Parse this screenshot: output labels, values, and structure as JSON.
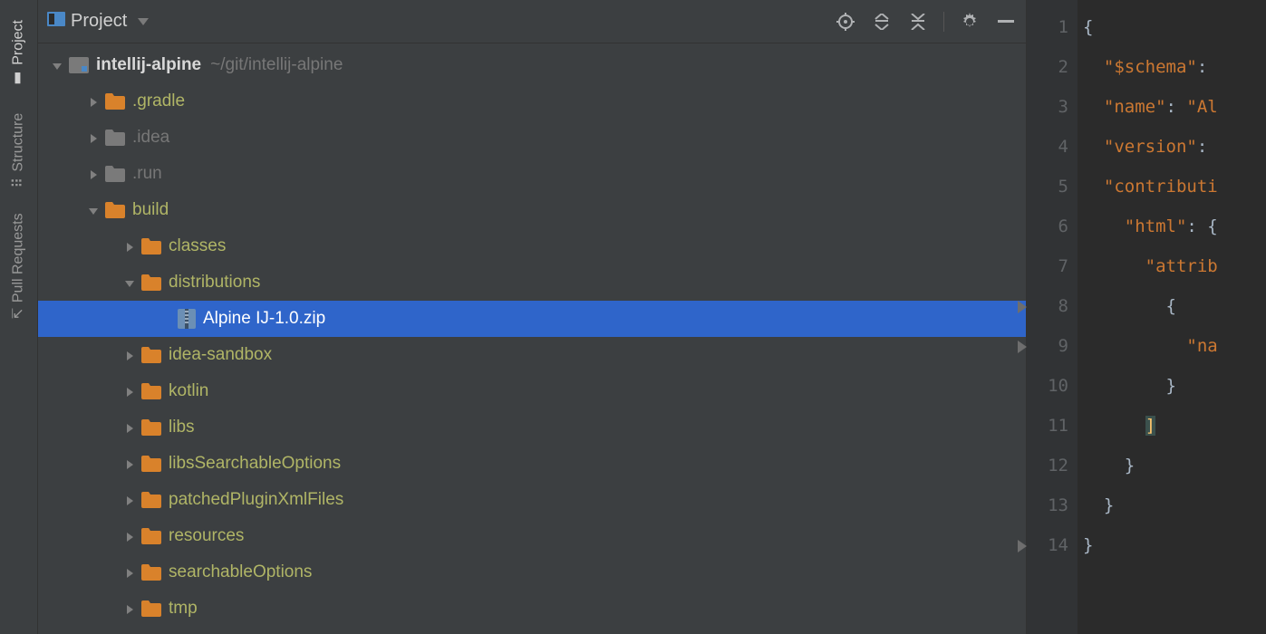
{
  "sidebar": {
    "tabs": [
      {
        "label": "Project",
        "active": true
      },
      {
        "label": "Structure",
        "active": false
      },
      {
        "label": "Pull Requests",
        "active": false
      }
    ]
  },
  "panel": {
    "title": "Project"
  },
  "tree": {
    "root": {
      "label": "intellij-alpine",
      "path": "~/git/intellij-alpine"
    },
    "nodes": [
      {
        "indent": 1,
        "kind": "folder-orange",
        "label": ".gradle",
        "expand": "closed"
      },
      {
        "indent": 1,
        "kind": "folder-gray",
        "label": ".idea",
        "expand": "closed",
        "dim": true
      },
      {
        "indent": 1,
        "kind": "folder-gray",
        "label": ".run",
        "expand": "closed",
        "dim": true
      },
      {
        "indent": 1,
        "kind": "folder-orange",
        "label": "build",
        "expand": "open"
      },
      {
        "indent": 2,
        "kind": "folder-orange",
        "label": "classes",
        "expand": "closed"
      },
      {
        "indent": 2,
        "kind": "folder-orange",
        "label": "distributions",
        "expand": "open"
      },
      {
        "indent": 3,
        "kind": "zip",
        "label": "Alpine IJ-1.0.zip",
        "selected": true
      },
      {
        "indent": 2,
        "kind": "folder-orange",
        "label": "idea-sandbox",
        "expand": "closed"
      },
      {
        "indent": 2,
        "kind": "folder-orange",
        "label": "kotlin",
        "expand": "closed"
      },
      {
        "indent": 2,
        "kind": "folder-orange",
        "label": "libs",
        "expand": "closed"
      },
      {
        "indent": 2,
        "kind": "folder-orange",
        "label": "libsSearchableOptions",
        "expand": "closed"
      },
      {
        "indent": 2,
        "kind": "folder-orange",
        "label": "patchedPluginXmlFiles",
        "expand": "closed"
      },
      {
        "indent": 2,
        "kind": "folder-orange",
        "label": "resources",
        "expand": "closed"
      },
      {
        "indent": 2,
        "kind": "folder-orange",
        "label": "searchableOptions",
        "expand": "closed"
      },
      {
        "indent": 2,
        "kind": "folder-orange",
        "label": "tmp",
        "expand": "closed"
      }
    ]
  },
  "editor": {
    "lines": [
      {
        "n": 1,
        "tokens": [
          {
            "t": "{",
            "c": "k-brace"
          }
        ]
      },
      {
        "n": 2,
        "tokens": [
          {
            "t": "  ",
            "c": ""
          },
          {
            "t": "\"$schema\"",
            "c": "k-str"
          },
          {
            "t": ":",
            "c": "k-brace"
          }
        ]
      },
      {
        "n": 3,
        "tokens": [
          {
            "t": "  ",
            "c": ""
          },
          {
            "t": "\"name\"",
            "c": "k-str"
          },
          {
            "t": ": ",
            "c": "k-brace"
          },
          {
            "t": "\"Al",
            "c": "k-str"
          }
        ]
      },
      {
        "n": 4,
        "tokens": [
          {
            "t": "  ",
            "c": ""
          },
          {
            "t": "\"version\"",
            "c": "k-str"
          },
          {
            "t": ":",
            "c": "k-brace"
          }
        ]
      },
      {
        "n": 5,
        "tokens": [
          {
            "t": "  ",
            "c": ""
          },
          {
            "t": "\"contributi",
            "c": "k-str"
          }
        ]
      },
      {
        "n": 6,
        "tokens": [
          {
            "t": "    ",
            "c": ""
          },
          {
            "t": "\"html\"",
            "c": "k-str"
          },
          {
            "t": ": {",
            "c": "k-brace"
          }
        ]
      },
      {
        "n": 7,
        "tokens": [
          {
            "t": "      ",
            "c": ""
          },
          {
            "t": "\"attrib",
            "c": "k-str"
          }
        ]
      },
      {
        "n": 8,
        "tokens": [
          {
            "t": "        {",
            "c": "k-brace"
          }
        ],
        "fold": true
      },
      {
        "n": 9,
        "tokens": [
          {
            "t": "          ",
            "c": ""
          },
          {
            "t": "\"na",
            "c": "k-str"
          }
        ],
        "fold": true
      },
      {
        "n": 10,
        "tokens": [
          {
            "t": "        }",
            "c": "k-brace"
          }
        ]
      },
      {
        "n": 11,
        "tokens": [
          {
            "t": "      ",
            "c": ""
          },
          {
            "t": "]",
            "c": "k-bracket"
          }
        ]
      },
      {
        "n": 12,
        "tokens": [
          {
            "t": "    }",
            "c": "k-brace"
          }
        ]
      },
      {
        "n": 13,
        "tokens": [
          {
            "t": "  }",
            "c": "k-brace"
          }
        ]
      },
      {
        "n": 14,
        "tokens": [
          {
            "t": "}",
            "c": "k-brace"
          }
        ],
        "fold": true
      }
    ]
  }
}
